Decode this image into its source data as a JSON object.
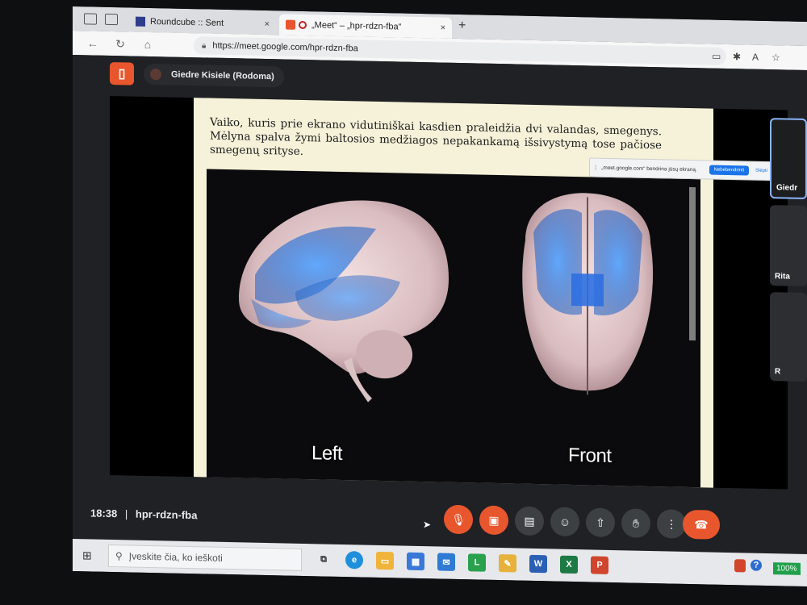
{
  "browser": {
    "tabs": [
      {
        "label": "Roundcube :: Sent",
        "close": "×"
      },
      {
        "label": "„Meet“ – „hpr-rdzn-fba“",
        "close": "×"
      }
    ],
    "new_tab": "+",
    "url": "https://meet.google.com/hpr-rdzn-fba"
  },
  "meet": {
    "presenter": "Giedre Kisiele (Rodoma)",
    "slide": {
      "text": "Vaiko, kuris prie ekrano vidutiniškai kasdien praleidžia dvi valandas, smegenys. Mėlyna spalva žymi baltosios medžiagos nepakankamą išsivystymą tose pačiose smegenų srityse.",
      "label_left": "Left",
      "label_front": "Front"
    },
    "share_notice": {
      "text": "„meet.google.com“ bendrina jūsų ekraną.",
      "stop_label": "Nebebendrinti",
      "hide_label": "Slėpti"
    },
    "participants": [
      {
        "name": "Giedr"
      },
      {
        "name": "Rita"
      },
      {
        "name": "R"
      }
    ],
    "time": "18:38",
    "separator": "|",
    "meeting_code": "hpr-rdzn-fba"
  },
  "taskbar": {
    "search_placeholder": "Įveskite čia, ko ieškoti",
    "battery": "100%"
  },
  "colors": {
    "accent_red": "#e8562e",
    "meet_bg": "#202124",
    "brain_highlight": "#3f86f0"
  }
}
